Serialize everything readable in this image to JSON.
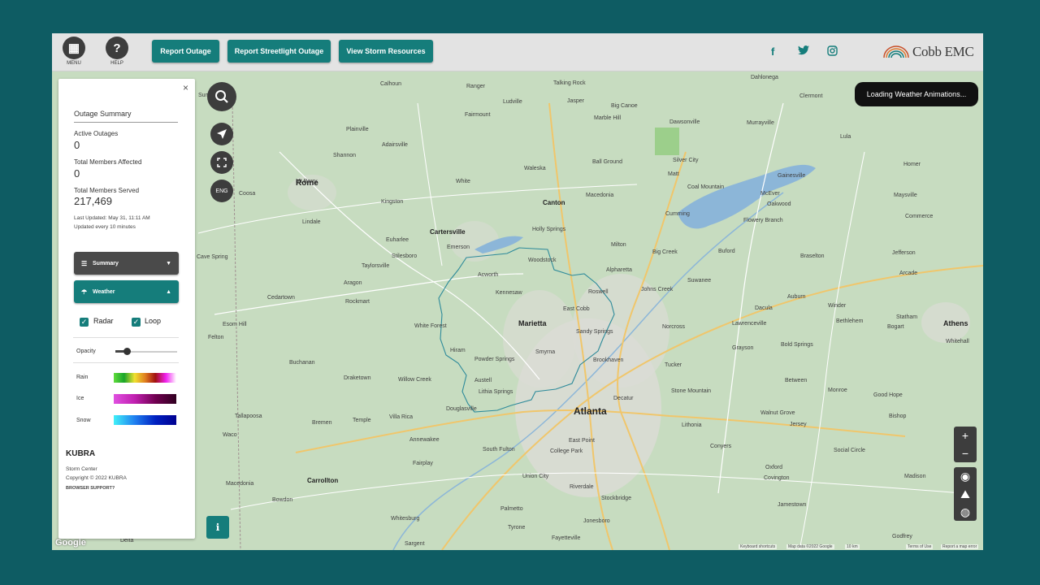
{
  "header": {
    "menu_label": "MENU",
    "help_label": "HELP",
    "buttons": [
      "Report Outage",
      "Report Streetlight Outage",
      "View Storm Resources"
    ],
    "social": [
      "f",
      "t",
      "ig"
    ],
    "logo_text": "Cobb EMC",
    "brand_color": "#157d7b"
  },
  "map": {
    "loading_text": "Loading Weather Animations...",
    "lang_label": "ENG",
    "zoom_in": "+",
    "zoom_out": "−",
    "google": "Google",
    "attribution": {
      "shortcuts": "Keyboard shortcuts",
      "data": "Map data ©2022 Google",
      "scale": "10 km",
      "terms": "Terms of Use",
      "report": "Report a map error"
    },
    "cities": [
      {
        "name": "Calhoun"
      },
      {
        "name": "Ranger"
      },
      {
        "name": "Talking Rock"
      },
      {
        "name": "Dahlonega"
      },
      {
        "name": "Clermont"
      },
      {
        "name": "Summerville"
      },
      {
        "name": "Ludville"
      },
      {
        "name": "Jasper"
      },
      {
        "name": "Big Canoe"
      },
      {
        "name": "Murrayville"
      },
      {
        "name": "Fairmount"
      },
      {
        "name": "Marble Hill"
      },
      {
        "name": "Dawsonville"
      },
      {
        "name": "Lula"
      },
      {
        "name": "Plainville"
      },
      {
        "name": "Adairsville"
      },
      {
        "name": "Shannon"
      },
      {
        "name": "Rome"
      },
      {
        "name": "Waleska"
      },
      {
        "name": "Ball Ground"
      },
      {
        "name": "Silver City"
      },
      {
        "name": "Gainesville"
      },
      {
        "name": "Mt Berry"
      },
      {
        "name": "White"
      },
      {
        "name": "Matt"
      },
      {
        "name": "Coal Mountain"
      },
      {
        "name": "Homer"
      },
      {
        "name": "Coosa"
      },
      {
        "name": "Kingston"
      },
      {
        "name": "Canton"
      },
      {
        "name": "Macedonia"
      },
      {
        "name": "McEver"
      },
      {
        "name": "Maysville"
      },
      {
        "name": "Lindale"
      },
      {
        "name": "Cartersville"
      },
      {
        "name": "Holly Springs"
      },
      {
        "name": "Cumming"
      },
      {
        "name": "Oakwood"
      },
      {
        "name": "Euharlee"
      },
      {
        "name": "Emerson"
      },
      {
        "name": "Milton"
      },
      {
        "name": "Flowery Branch"
      },
      {
        "name": "Commerce"
      },
      {
        "name": "Cave Spring"
      },
      {
        "name": "Stilesboro"
      },
      {
        "name": "Woodstock"
      },
      {
        "name": "Big Creek"
      },
      {
        "name": "Buford"
      },
      {
        "name": "Braselton"
      },
      {
        "name": "Jefferson"
      },
      {
        "name": "Taylorsville"
      },
      {
        "name": "Acworth"
      },
      {
        "name": "Alpharetta"
      },
      {
        "name": "Suwanee"
      },
      {
        "name": "Arcade"
      },
      {
        "name": "Aragon"
      },
      {
        "name": "Kennesaw"
      },
      {
        "name": "Roswell"
      },
      {
        "name": "Johns Creek"
      },
      {
        "name": "Dacula"
      },
      {
        "name": "Auburn"
      },
      {
        "name": "Cedartown"
      },
      {
        "name": "Rockmart"
      },
      {
        "name": "East Cobb"
      },
      {
        "name": "Winder"
      },
      {
        "name": "Bethlehem"
      },
      {
        "name": "Statham"
      },
      {
        "name": "Esom Hill"
      },
      {
        "name": "White Forest"
      },
      {
        "name": "Marietta"
      },
      {
        "name": "Sandy Springs"
      },
      {
        "name": "Norcross"
      },
      {
        "name": "Lawrenceville"
      },
      {
        "name": "Bogart"
      },
      {
        "name": "Athens"
      },
      {
        "name": "Felton"
      },
      {
        "name": "Hiram"
      },
      {
        "name": "Smyrna"
      },
      {
        "name": "Brookhaven"
      },
      {
        "name": "Bold Springs"
      },
      {
        "name": "Whitehall"
      },
      {
        "name": "Powder Springs"
      },
      {
        "name": "Tucker"
      },
      {
        "name": "Grayson"
      },
      {
        "name": "Buchanan"
      },
      {
        "name": "Draketown"
      },
      {
        "name": "Willow Creek"
      },
      {
        "name": "Austell"
      },
      {
        "name": "Lithia Springs"
      },
      {
        "name": "Decatur"
      },
      {
        "name": "Between"
      },
      {
        "name": "Monroe"
      },
      {
        "name": "Good Hope"
      },
      {
        "name": "Atlanta"
      },
      {
        "name": "Douglasville"
      },
      {
        "name": "Stone Mountain"
      },
      {
        "name": "Walnut Grove"
      },
      {
        "name": "Bishop"
      },
      {
        "name": "Tallapoosa"
      },
      {
        "name": "Bremen"
      },
      {
        "name": "Temple"
      },
      {
        "name": "Villa Rica"
      },
      {
        "name": "Lithonia"
      },
      {
        "name": "Jersey"
      },
      {
        "name": "Waco"
      },
      {
        "name": "Annewakee"
      },
      {
        "name": "South Fulton"
      },
      {
        "name": "East Point"
      },
      {
        "name": "College Park"
      },
      {
        "name": "Conyers"
      },
      {
        "name": "Social Circle"
      },
      {
        "name": "Fairplay"
      },
      {
        "name": "Union City"
      },
      {
        "name": "Oxford"
      },
      {
        "name": "Covington"
      },
      {
        "name": "Madison"
      },
      {
        "name": "Macedonia"
      },
      {
        "name": "Carrollton"
      },
      {
        "name": "Palmetto"
      },
      {
        "name": "Riverdale"
      },
      {
        "name": "Stockbridge"
      },
      {
        "name": "Bowdon"
      },
      {
        "name": "Jonesboro"
      },
      {
        "name": "Jamestown"
      },
      {
        "name": "Whitesburg"
      },
      {
        "name": "Tyrone"
      },
      {
        "name": "Fayetteville"
      },
      {
        "name": "Sargent"
      },
      {
        "name": "Delta"
      },
      {
        "name": "Godfrey"
      }
    ]
  },
  "panel": {
    "close": "×",
    "title": "Outage Summary",
    "active_outages_label": "Active Outages",
    "active_outages": "0",
    "members_affected_label": "Total Members Affected",
    "members_affected": "0",
    "members_served_label": "Total Members Served",
    "members_served": "217,469",
    "last_updated": "Last Updated:  May 31, 11:11 AM",
    "update_freq": "Updated every 10 minutes",
    "summary_label": "Summary",
    "weather_label": "Weather",
    "radar_label": "Radar",
    "loop_label": "Loop",
    "opacity_label": "Opacity",
    "opacity_value": 0.2,
    "rain_label": "Rain",
    "ice_label": "Ice",
    "snow_label": "Snow",
    "kubra_logo": "KUBRA",
    "storm_center": "Storm Center",
    "copyright": "Copyright © 2022 KUBRA",
    "browser_support": "BROWSER SUPPORT?"
  }
}
